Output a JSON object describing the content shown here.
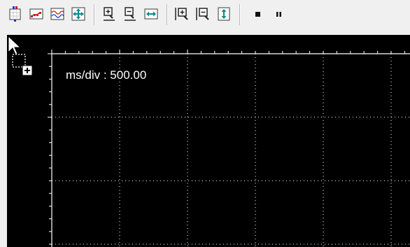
{
  "toolbar": {
    "buttons": [
      {
        "name": "channel-select-icon"
      },
      {
        "name": "trace-points-icon"
      },
      {
        "name": "waveform-icon"
      },
      {
        "name": "pan-move-icon"
      },
      {
        "name": "zoom-in-icon"
      },
      {
        "name": "zoom-out-icon"
      },
      {
        "name": "fit-horizontal-icon"
      },
      {
        "name": "zoom-in-vertical-icon"
      },
      {
        "name": "zoom-out-vertical-icon"
      },
      {
        "name": "fit-vertical-icon"
      },
      {
        "name": "stop-icon"
      },
      {
        "name": "pause-icon"
      }
    ]
  },
  "scope": {
    "readout": "ms/div : 500.00",
    "background": "#000000",
    "grid_color": "#ffffff"
  },
  "cursor": {
    "name": "drag-add-cursor-icon"
  }
}
